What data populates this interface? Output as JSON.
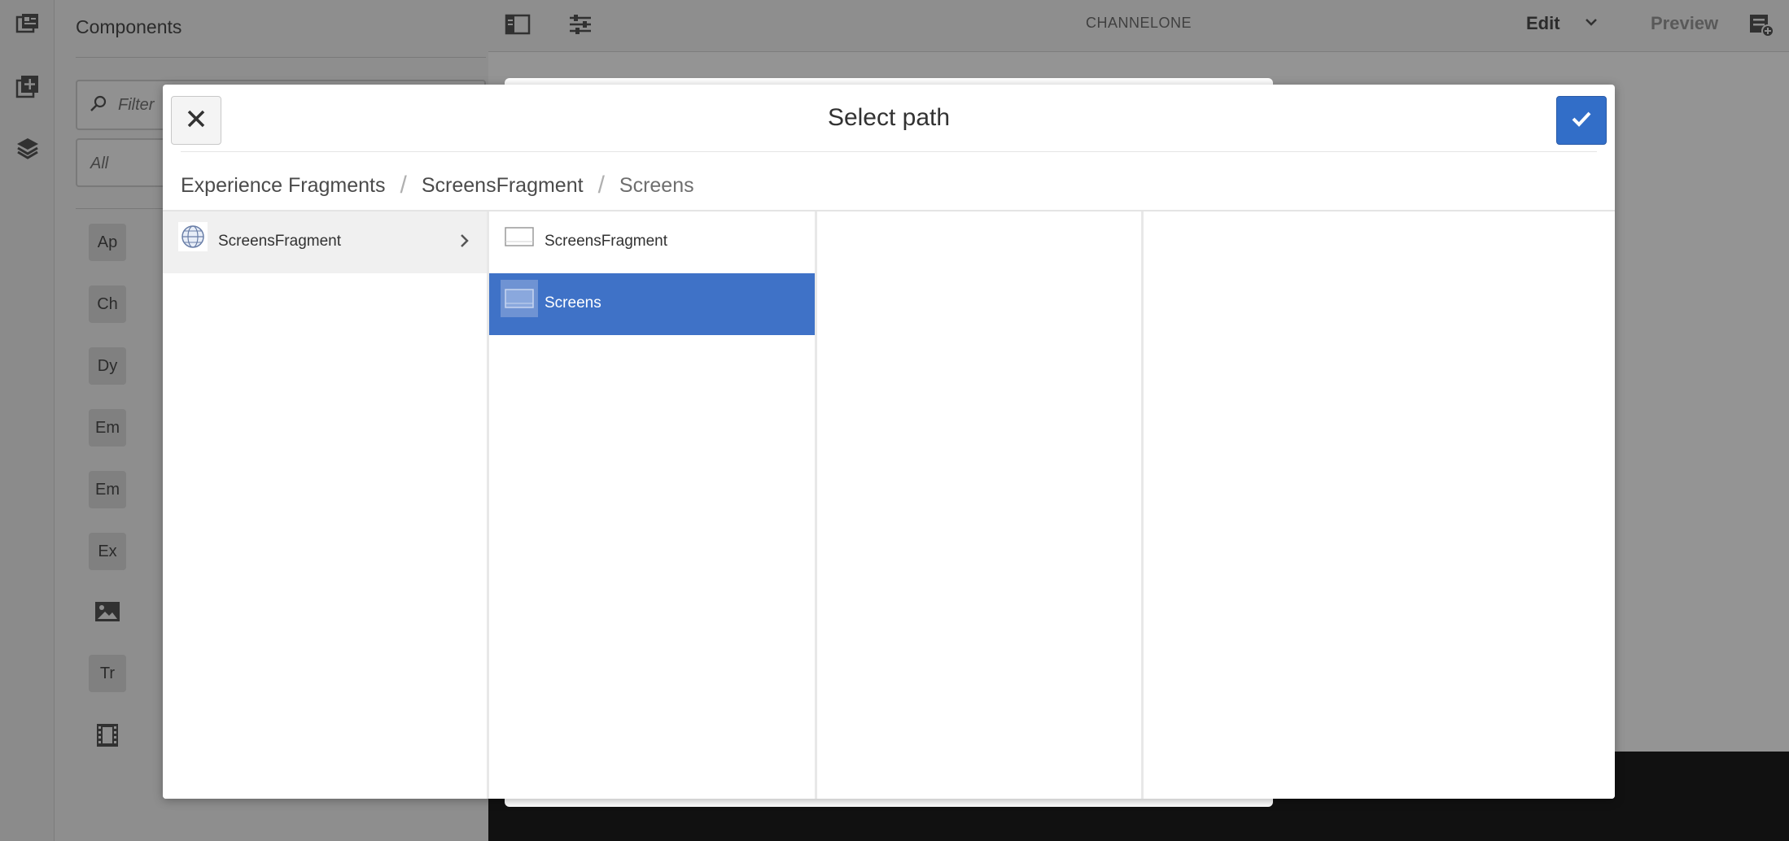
{
  "sidebar_rail": {
    "icons": [
      "page-content-icon",
      "add-component-icon",
      "layers-icon"
    ]
  },
  "side_panel": {
    "title": "Components",
    "filter_placeholder": "Filter",
    "group_select_value": "All",
    "items": [
      {
        "badge": "Ap"
      },
      {
        "badge": "Ch"
      },
      {
        "badge": "Dy"
      },
      {
        "badge": "Em"
      },
      {
        "badge": "Em"
      },
      {
        "badge": "Ex"
      },
      {
        "badge": "",
        "icon": "image-icon"
      },
      {
        "badge": "Tr"
      },
      {
        "badge": "",
        "icon": "video-icon"
      }
    ]
  },
  "topbar": {
    "page_title": "CHANNELONE",
    "mode_label": "Edit",
    "preview_label": "Preview"
  },
  "dialog": {
    "title": "Select path",
    "breadcrumb": [
      "Experience Fragments",
      "ScreensFragment",
      "Screens"
    ],
    "columns": [
      {
        "items": [
          {
            "label": "ScreensFragment",
            "state": "active",
            "has_children": true,
            "thumb": "globe-thumbnail"
          }
        ]
      },
      {
        "items": [
          {
            "label": "ScreensFragment",
            "state": "normal",
            "has_children": false,
            "thumb": "page-thumbnail"
          },
          {
            "label": "Screens",
            "state": "selected",
            "has_children": false,
            "thumb": "page-thumbnail"
          }
        ]
      },
      {
        "items": []
      },
      {
        "items": []
      }
    ]
  },
  "colors": {
    "accent": "#326ec8",
    "selected_row": "#3f72c7",
    "topbar_bg": "#f5f5f5",
    "dark_canvas": "#1e1e1e"
  }
}
